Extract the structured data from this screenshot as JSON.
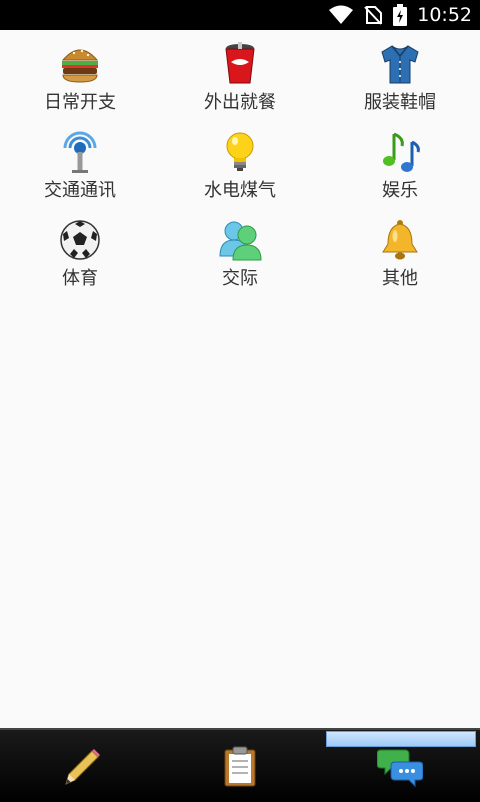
{
  "status_bar": {
    "time": "10:52",
    "icons": [
      "wifi-icon",
      "no-sim-icon",
      "battery-charging-icon"
    ]
  },
  "categories": [
    {
      "label": "日常开支",
      "icon": "hamburger-icon"
    },
    {
      "label": "外出就餐",
      "icon": "soda-cup-icon"
    },
    {
      "label": "服装鞋帽",
      "icon": "shirt-icon"
    },
    {
      "label": "交通通讯",
      "icon": "antenna-icon"
    },
    {
      "label": "水电煤气",
      "icon": "lightbulb-icon"
    },
    {
      "label": "娱乐",
      "icon": "music-note-icon"
    },
    {
      "label": "体育",
      "icon": "soccer-ball-icon"
    },
    {
      "label": "交际",
      "icon": "people-icon"
    },
    {
      "label": "其他",
      "icon": "bell-icon"
    }
  ],
  "tabs": [
    {
      "icon": "pencil-icon"
    },
    {
      "icon": "clipboard-icon"
    },
    {
      "icon": "chat-bubbles-icon",
      "selected": true
    }
  ],
  "colors": {
    "status_bar": "#000000",
    "page_bg": "#fafafa",
    "tab_bar": "#111111",
    "tab_highlight": "#a9d1f7"
  }
}
